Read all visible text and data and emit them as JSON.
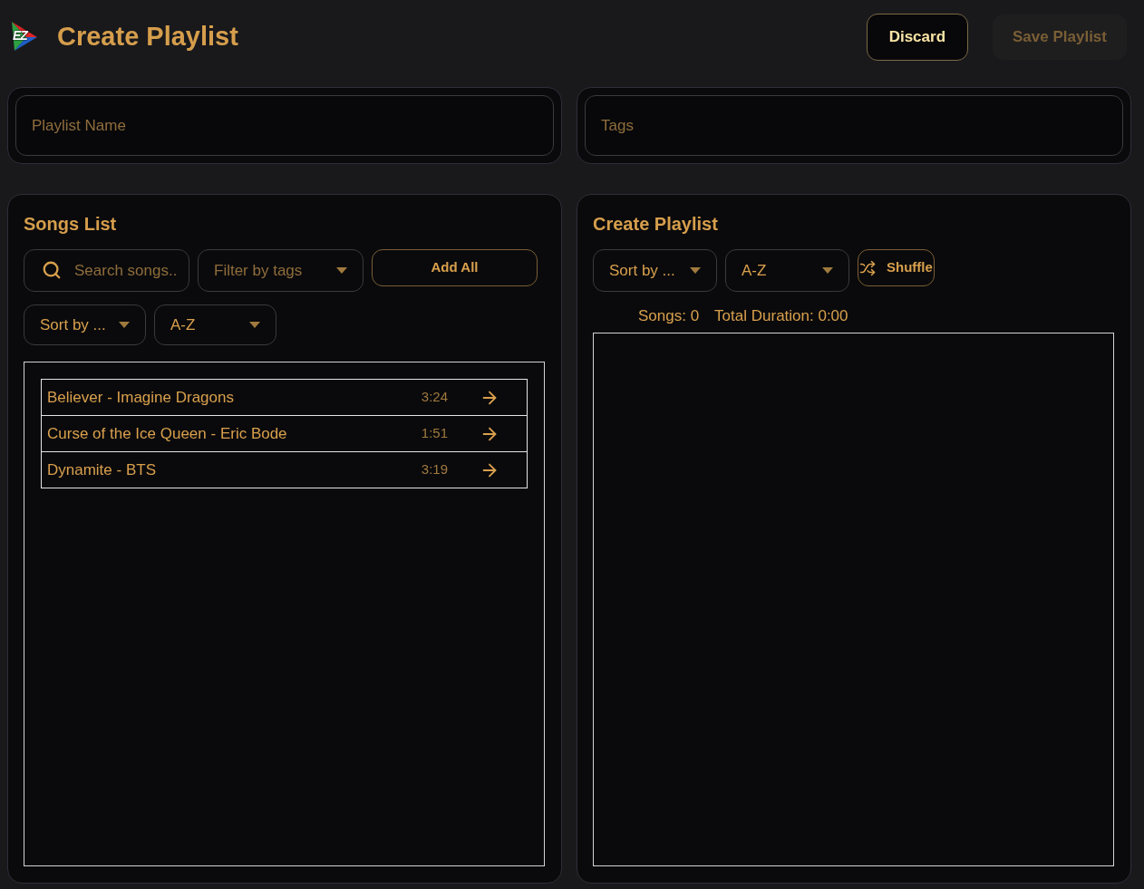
{
  "header": {
    "logo_text": "EZ",
    "title": "Create Playlist",
    "buttons": [
      {
        "label": "Discard",
        "disabled": false
      },
      {
        "label": "Save Playlist",
        "disabled": true
      }
    ]
  },
  "fields": [
    {
      "placeholder": "Playlist Name"
    },
    {
      "placeholder": "Tags"
    }
  ],
  "songs_list": {
    "title": "Songs List",
    "search": {
      "placeholder": "Search songs.."
    },
    "tag_filter": {
      "placeholder": "Filter by tags"
    },
    "add_all": "Add All",
    "sort_by": {
      "value": "Sort by ..."
    },
    "order": {
      "value": "A-Z"
    },
    "songs": [
      {
        "title": "Believer - Imagine Dragons",
        "duration": "3:24"
      },
      {
        "title": "Curse of the Ice Queen - Eric Bode",
        "duration": "1:51"
      },
      {
        "title": "Dynamite - BTS",
        "duration": "3:19"
      }
    ]
  },
  "playlist": {
    "title": "Create Playlist",
    "sort_by": {
      "value": "Sort by ..."
    },
    "order": {
      "value": "A-Z"
    },
    "shuffle": "Shuffle",
    "songs_count": "Songs: 0",
    "total_duration": "Total Duration: 0:00"
  }
}
